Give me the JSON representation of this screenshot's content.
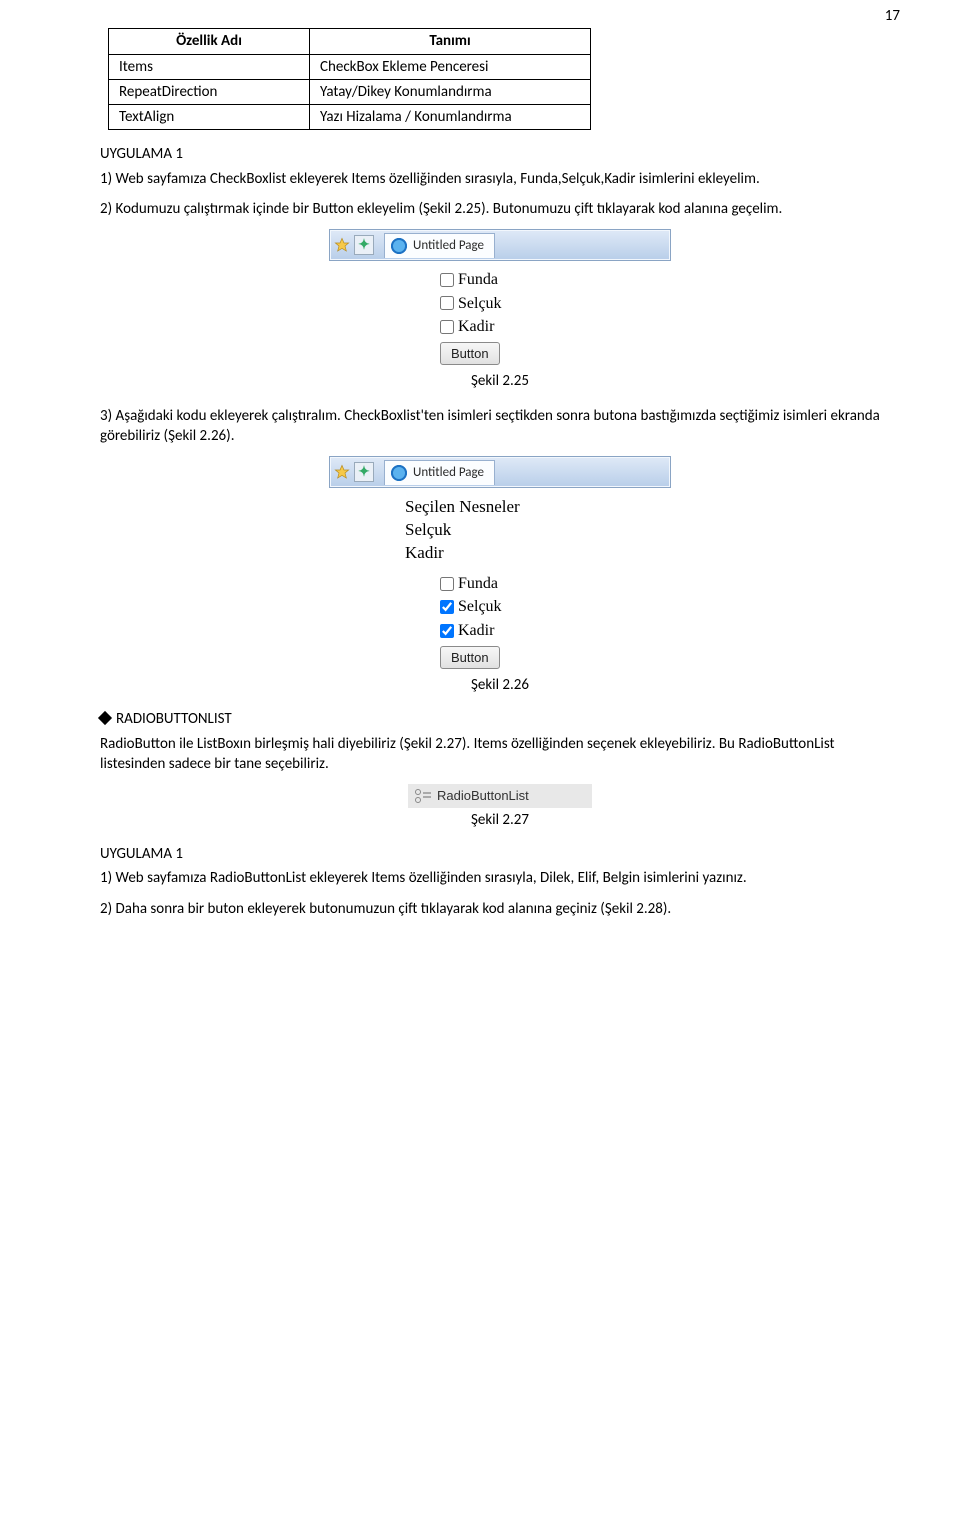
{
  "page_number": "17",
  "table": {
    "headers": [
      "Özellik Adı",
      "Tanımı"
    ],
    "rows": [
      [
        "Items",
        "CheckBox Ekleme Penceresi"
      ],
      [
        "RepeatDirection",
        "Yatay/Dikey Konumlandırma"
      ],
      [
        "TextAlign",
        "Yazı Hizalama / Konumlandırma"
      ]
    ]
  },
  "uygulama1_title": "UYGULAMA 1",
  "para1": "1) Web sayfamıza CheckBoxlist ekleyerek Items özelliğinden sırasıyla, Funda,Selçuk,Kadir isimlerini ekleyelim.",
  "para2": "2) Kodumuzu çalıştırmak içinde bir Button ekleyelim (Şekil 2.25). Butonumuzu çift tıklayarak kod alanına geçelim.",
  "browser_tab_label": "Untitled Page",
  "cb_items": [
    "Funda",
    "Selçuk",
    "Kadir"
  ],
  "button_label": "Button",
  "fig25_caption": "Şekil 2.25",
  "para3": "3) Aşağıdaki kodu ekleyerek çalıştıralım. CheckBoxlist'ten isimleri seçtikden sonra butona bastığımızda seçtiğimiz isimleri ekranda görebiliriz (Şekil 2.26).",
  "result_lines": [
    "Seçilen Nesneler",
    "Selçuk",
    "Kadir"
  ],
  "cb_items2": [
    {
      "label": "Funda",
      "checked": false
    },
    {
      "label": "Selçuk",
      "checked": true
    },
    {
      "label": "Kadir",
      "checked": true
    }
  ],
  "fig26_caption": "Şekil 2.26",
  "radiobuttonlist_heading": "RADIOBUTTONLIST",
  "radiobuttonlist_text": "RadioButton ile ListBoxın birleşmiş hali diyebiliriz (Şekil 2.27). Items özelliğinden seçenek ekleyebiliriz. Bu RadioButtonList listesinden sadece bir tane seçebiliriz.",
  "toolbox_label": "RadioButtonList",
  "fig27_caption": "Şekil 2.27",
  "uygulama1b_title": "UYGULAMA 1",
  "para4": "1) Web sayfamıza RadioButtonList ekleyerek Items özelliğinden sırasıyla, Dilek, Elif, Belgin isimlerini yazınız.",
  "para5": "2) Daha sonra bir buton ekleyerek butonumuzun çift tıklayarak kod alanına geçiniz (Şekil 2.28)."
}
